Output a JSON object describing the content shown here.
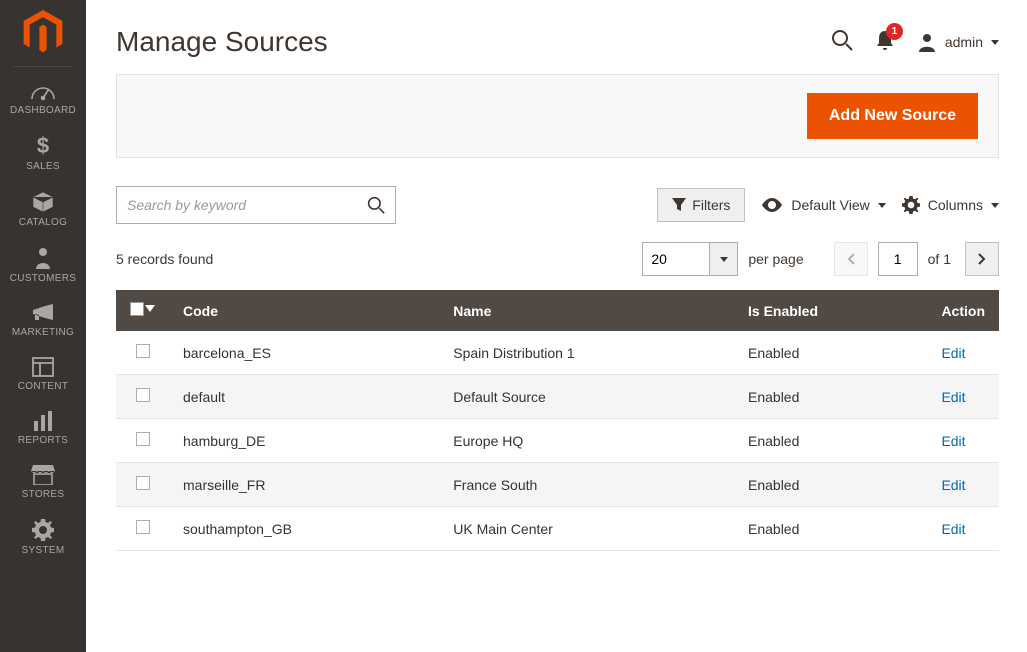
{
  "sidebar": {
    "items": [
      {
        "label": "DASHBOARD"
      },
      {
        "label": "SALES"
      },
      {
        "label": "CATALOG"
      },
      {
        "label": "CUSTOMERS"
      },
      {
        "label": "MARKETING"
      },
      {
        "label": "CONTENT"
      },
      {
        "label": "REPORTS"
      },
      {
        "label": "STORES"
      },
      {
        "label": "SYSTEM"
      }
    ]
  },
  "header": {
    "title": "Manage Sources",
    "notification_count": "1",
    "username": "admin"
  },
  "actions": {
    "add_new": "Add New Source"
  },
  "toolbar": {
    "search_placeholder": "Search by keyword",
    "filters": "Filters",
    "default_view": "Default View",
    "columns": "Columns"
  },
  "pager": {
    "records_found": "5 records found",
    "page_size": "20",
    "per_page": "per page",
    "current_page": "1",
    "of": "of 1"
  },
  "table": {
    "headers": {
      "code": "Code",
      "name": "Name",
      "enabled": "Is Enabled",
      "action": "Action"
    },
    "edit_label": "Edit",
    "rows": [
      {
        "code": "barcelona_ES",
        "name": "Spain Distribution 1",
        "enabled": "Enabled"
      },
      {
        "code": "default",
        "name": "Default Source",
        "enabled": "Enabled"
      },
      {
        "code": "hamburg_DE",
        "name": "Europe HQ",
        "enabled": "Enabled"
      },
      {
        "code": "marseille_FR",
        "name": "France South",
        "enabled": "Enabled"
      },
      {
        "code": "southampton_GB",
        "name": "UK Main Center",
        "enabled": "Enabled"
      }
    ]
  }
}
